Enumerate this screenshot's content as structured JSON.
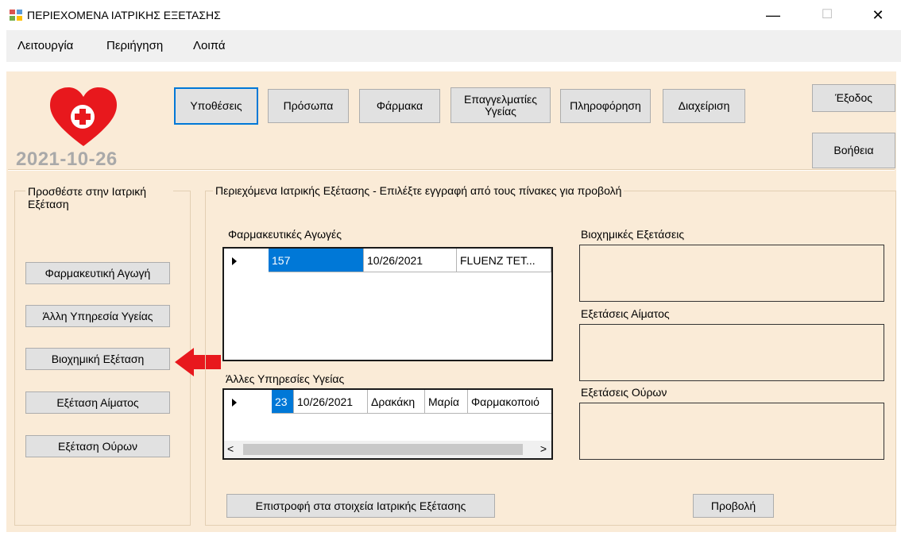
{
  "window": {
    "title": "ΠΕΡΙΕΧΟΜΕΝΑ ΙΑΤΡΙΚΗΣ ΕΞΕΤΑΣΗΣ",
    "minimize": "—",
    "maximize": "☐",
    "close": "✕"
  },
  "menu": [
    "Λειτουργία",
    "Περιήγηση",
    "Λοιπά"
  ],
  "header": {
    "date": "2021-10-26",
    "nav_buttons": [
      "Υποθέσεις",
      "Πρόσωπα",
      "Φάρμακα",
      "Επαγγελματίες Υγείας",
      "Πληροφόρηση",
      "Διαχείριση"
    ],
    "exit_label": "Έξοδος",
    "help_label": "Βοήθεια"
  },
  "left_group": {
    "title": "Προσθέστε στην Ιατρική Εξέταση",
    "buttons": [
      "Φαρμακευτική Αγωγή",
      "Άλλη Υπηρεσία Υγείας",
      "Βιοχημική Εξέταση",
      "Εξέταση Αίματος",
      "Εξέταση Ούρων"
    ]
  },
  "main_group": {
    "title": "Περιεχόμενα Ιατρικής Εξέτασης - Επιλέξτε εγγραφή από τους πίνακες για προβολή",
    "medications_label": "Φαρμακευτικές Αγωγές",
    "medications_row": [
      "157",
      "10/26/2021",
      "FLUENZ TET..."
    ],
    "other_services_label": "Άλλες Υπηρεσίες Υγείας",
    "other_services_row": [
      "23",
      "10/26/2021",
      "Δρακάκη",
      "Μαρία",
      "Φαρμακοποιό"
    ],
    "biochem_label": "Βιοχημικές Εξετάσεις",
    "blood_label": "Εξετάσεις Αίματος",
    "urine_label": "Εξετάσεις Ούρων",
    "back_button": "Επιστροφή στα στοιχεία Ιατρικής Εξέτασης",
    "view_button": "Προβολή",
    "scroll_left": "<",
    "scroll_right": ">"
  },
  "colors": {
    "panel_bg": "#faebd7",
    "heart": "#e8181d",
    "arrow": "#e8181d",
    "selection": "#0078d7"
  }
}
